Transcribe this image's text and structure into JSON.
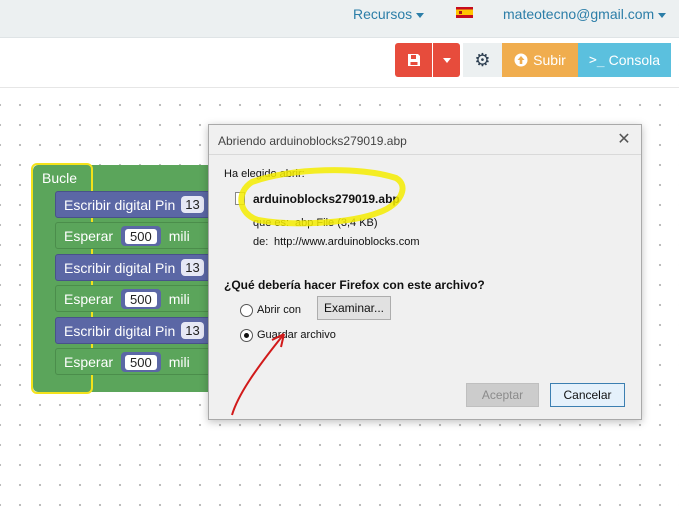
{
  "navbar": {
    "recursos_label": "Recursos",
    "language_flag": "spain-flag",
    "user_email": "mateotecno@gmail.com"
  },
  "toolbar": {
    "upload_label": "Subir",
    "console_label": "Consola",
    "colors": {
      "save": "#e74c3c",
      "upload": "#f0ad4e",
      "console": "#5bc0de"
    }
  },
  "workspace": {
    "loop_label": "Bucle",
    "blocks": [
      {
        "kind": "write",
        "text": "Escribir digital Pin",
        "value": "13"
      },
      {
        "kind": "wait",
        "text": "Esperar",
        "value": "500",
        "suffix": "mili"
      },
      {
        "kind": "write",
        "text": "Escribir digital Pin",
        "value": "13"
      },
      {
        "kind": "wait",
        "text": "Esperar",
        "value": "500",
        "suffix": "mili"
      },
      {
        "kind": "write",
        "text": "Escribir digital Pin",
        "value": "13"
      },
      {
        "kind": "wait",
        "text": "Esperar",
        "value": "500",
        "suffix": "mili"
      }
    ]
  },
  "dialog": {
    "title": "Abriendo arduinoblocks279019.abp",
    "chosen_label": "Ha elegido abrir:",
    "file_name": "arduinoblocks279019.abp",
    "type_label": "que es:",
    "type_value": "abp File (3,4 KB)",
    "from_label": "de:",
    "from_value": "http://www.arduinoblocks.com",
    "question": "¿Qué debería hacer Firefox con este archivo?",
    "open_with_label": "Abrir con",
    "browse_label": "Examinar...",
    "save_file_label": "Guardar archivo",
    "selected_option": "Guardar archivo",
    "accept_label": "Aceptar",
    "cancel_label": "Cancelar"
  }
}
